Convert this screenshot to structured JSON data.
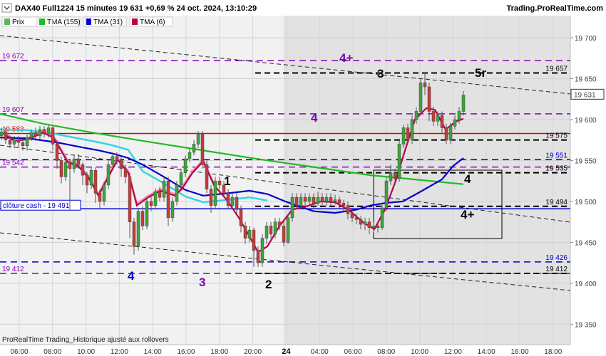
{
  "header": {
    "title": "DAX40 Full1224 15 minutes 19 631 +0,69 % 24 oct. 2024, 13:10:29",
    "source": "Trading.ProRealTime.com"
  },
  "legend": [
    {
      "label": "Prix",
      "color": "#5ab75a"
    },
    {
      "label": "TMA (155)",
      "color": "#22bb22"
    },
    {
      "label": "TMA (31)",
      "color": "#0000cc"
    },
    {
      "label": "TMA (6)",
      "color": "#b8004f"
    }
  ],
  "footer": "ProRealTime Trading_Historique ajusté aux rollovers",
  "chart_data": {
    "type": "candlestick",
    "x_ticks": [
      "06:00",
      "08:00",
      "10:00",
      "12:00",
      "14:00",
      "16:00",
      "18:00",
      "20:00",
      "24",
      "04:00",
      "06:00",
      "08:00",
      "10:00",
      "12:00",
      "14:00",
      "16:00",
      "18:00"
    ],
    "y_ticks": [
      19350,
      19400,
      19450,
      19500,
      19550,
      19600,
      19650,
      19700
    ],
    "ylim": [
      19325,
      19727
    ],
    "last_price": 19631,
    "last_price_label": "19 631",
    "levels": [
      {
        "value": 19672,
        "label": "19 672",
        "color": "#8a00b8",
        "style": "dashed",
        "side": "left"
      },
      {
        "value": 19657,
        "label": "19 657",
        "color": "#000000",
        "style": "dashed",
        "side": "right"
      },
      {
        "value": 19607,
        "label": "19 607",
        "color": "#8a00b8",
        "style": "dashed",
        "side": "left"
      },
      {
        "value": 19583,
        "label": "19 583",
        "color": "#dd0000",
        "style": "solid",
        "side": "left"
      },
      {
        "value": 19575,
        "label": "19 575",
        "color": "#000000",
        "style": "dashed",
        "side": "right"
      },
      {
        "value": 19551,
        "label": "19 551",
        "color": "#0000cc",
        "style": "dashed",
        "side": "right"
      },
      {
        "value": 19542,
        "label": "19 542",
        "color": "#8a00b8",
        "style": "dashed",
        "side": "left"
      },
      {
        "value": 19535,
        "label": "19 535",
        "color": "#000000",
        "style": "dashed",
        "side": "right"
      },
      {
        "value": 19494,
        "label": "19 494",
        "color": "#000000",
        "style": "dashed",
        "side": "right"
      },
      {
        "value": 19491,
        "label": "clôture cash -  19 491",
        "color": "#0000cc",
        "style": "solid",
        "side": "left-box"
      },
      {
        "value": 19426,
        "label": "19 426",
        "color": "#0000cc",
        "style": "dashed",
        "side": "right"
      },
      {
        "value": 19412,
        "label": "19 412",
        "color": "#8a00b8",
        "style": "dashed",
        "side": "left"
      },
      {
        "value": 19412,
        "label": "19 412",
        "color": "#000000",
        "style": "dashed",
        "side": "right"
      }
    ],
    "annotations": [
      {
        "text": "4+",
        "color": "#7a00b0"
      },
      {
        "text": "3",
        "color": "#000000"
      },
      {
        "text": "5r",
        "color": "#000000"
      },
      {
        "text": "4",
        "color": "#7a00b0"
      },
      {
        "text": "1",
        "color": "#000000"
      },
      {
        "text": "4",
        "color": "#000000"
      },
      {
        "text": "4+",
        "color": "#000000"
      },
      {
        "text": "4",
        "color": "#0000cc"
      },
      {
        "text": "3",
        "color": "#7a00b0"
      },
      {
        "text": "2",
        "color": "#000000"
      }
    ],
    "series": [
      {
        "name": "TMA (155)",
        "color": "#22bb22",
        "points": [
          [
            0,
            19607
          ],
          [
            60,
            19595
          ],
          [
            130,
            19584
          ],
          [
            200,
            19574
          ],
          [
            280,
            19563
          ],
          [
            360,
            19552
          ],
          [
            440,
            19542
          ],
          [
            520,
            19532
          ],
          [
            580,
            19527
          ],
          [
            650,
            19521
          ]
        ]
      },
      {
        "name": "TMA (31)",
        "color": "#0000cc",
        "points": [
          [
            0,
            19578
          ],
          [
            40,
            19577
          ],
          [
            80,
            19572
          ],
          [
            110,
            19567
          ],
          [
            140,
            19562
          ],
          [
            160,
            19558
          ],
          [
            180,
            19553
          ],
          [
            200,
            19545
          ],
          [
            230,
            19530
          ],
          [
            260,
            19514
          ],
          [
            285,
            19507
          ],
          [
            320,
            19510
          ],
          [
            350,
            19513
          ],
          [
            375,
            19509
          ],
          [
            400,
            19500
          ],
          [
            420,
            19494
          ],
          [
            440,
            19488
          ],
          [
            470,
            19486
          ],
          [
            500,
            19490
          ],
          [
            520,
            19495
          ],
          [
            540,
            19498
          ],
          [
            565,
            19500
          ],
          [
            590,
            19512
          ],
          [
            620,
            19527
          ],
          [
            635,
            19543
          ],
          [
            650,
            19553
          ]
        ]
      },
      {
        "name": "TMA (6)",
        "color": "#b8004f",
        "points": [
          [
            5,
            19583
          ],
          [
            20,
            19574
          ],
          [
            40,
            19576
          ],
          [
            60,
            19584
          ],
          [
            75,
            19578
          ],
          [
            95,
            19548
          ],
          [
            110,
            19543
          ],
          [
            125,
            19528
          ],
          [
            138,
            19507
          ],
          [
            152,
            19530
          ],
          [
            165,
            19551
          ],
          [
            180,
            19535
          ],
          [
            192,
            19495
          ],
          [
            208,
            19505
          ],
          [
            225,
            19513
          ],
          [
            245,
            19507
          ],
          [
            255,
            19515
          ],
          [
            270,
            19535
          ],
          [
            285,
            19549
          ],
          [
            300,
            19520
          ],
          [
            318,
            19502
          ],
          [
            335,
            19480
          ],
          [
            350,
            19457
          ],
          [
            362,
            19438
          ],
          [
            375,
            19445
          ],
          [
            392,
            19470
          ],
          [
            410,
            19490
          ],
          [
            430,
            19494
          ],
          [
            450,
            19500
          ],
          [
            470,
            19499
          ],
          [
            490,
            19489
          ],
          [
            510,
            19474
          ],
          [
            525,
            19466
          ],
          [
            540,
            19490
          ],
          [
            555,
            19525
          ],
          [
            568,
            19562
          ],
          [
            582,
            19600
          ],
          [
            598,
            19614
          ],
          [
            610,
            19612
          ],
          [
            625,
            19588
          ],
          [
            640,
            19598
          ],
          [
            650,
            19601
          ]
        ]
      }
    ],
    "candles": [
      [
        0,
        19580,
        19585,
        19575,
        19590
      ],
      [
        6,
        19585,
        19575,
        19570,
        19590
      ],
      [
        12,
        19575,
        19570,
        19565,
        19580
      ],
      [
        18,
        19570,
        19575,
        19565,
        19580
      ],
      [
        24,
        19575,
        19572,
        19566,
        19580
      ],
      [
        30,
        19572,
        19568,
        19562,
        19576
      ],
      [
        36,
        19568,
        19578,
        19562,
        19582
      ],
      [
        42,
        19578,
        19584,
        19574,
        19588
      ],
      [
        48,
        19584,
        19580,
        19574,
        19590
      ],
      [
        54,
        19580,
        19588,
        19576,
        19592
      ],
      [
        60,
        19588,
        19583,
        19578,
        19592
      ],
      [
        66,
        19583,
        19590,
        19578,
        19594
      ],
      [
        72,
        19590,
        19570,
        19562,
        19592
      ],
      [
        78,
        19570,
        19550,
        19540,
        19575
      ],
      [
        84,
        19550,
        19530,
        19522,
        19555
      ],
      [
        90,
        19530,
        19548,
        19525,
        19552
      ],
      [
        96,
        19548,
        19540,
        19490,
        19552
      ],
      [
        102,
        19540,
        19552,
        19535,
        19556
      ],
      [
        108,
        19552,
        19545,
        19540,
        19558
      ],
      [
        114,
        19545,
        19532,
        19520,
        19548
      ],
      [
        120,
        19532,
        19520,
        19510,
        19536
      ],
      [
        126,
        19520,
        19538,
        19515,
        19542
      ],
      [
        132,
        19538,
        19510,
        19498,
        19542
      ],
      [
        138,
        19510,
        19500,
        19490,
        19514
      ],
      [
        144,
        19500,
        19520,
        19495,
        19524
      ],
      [
        150,
        19520,
        19545,
        19515,
        19550
      ],
      [
        156,
        19545,
        19555,
        19540,
        19560
      ],
      [
        162,
        19555,
        19550,
        19545,
        19560
      ],
      [
        168,
        19550,
        19540,
        19530,
        19555
      ],
      [
        174,
        19540,
        19530,
        19522,
        19545
      ],
      [
        180,
        19530,
        19475,
        19455,
        19535
      ],
      [
        186,
        19475,
        19445,
        19435,
        19480
      ],
      [
        192,
        19445,
        19488,
        19440,
        19492
      ],
      [
        198,
        19488,
        19470,
        19465,
        19494
      ],
      [
        204,
        19470,
        19500,
        19466,
        19505
      ],
      [
        210,
        19500,
        19495,
        19488,
        19506
      ],
      [
        216,
        19495,
        19512,
        19490,
        19516
      ],
      [
        222,
        19512,
        19505,
        19500,
        19518
      ],
      [
        228,
        19505,
        19525,
        19500,
        19530
      ],
      [
        234,
        19525,
        19480,
        19470,
        19530
      ],
      [
        240,
        19480,
        19500,
        19475,
        19505
      ],
      [
        246,
        19500,
        19520,
        19495,
        19525
      ],
      [
        252,
        19520,
        19535,
        19515,
        19540
      ],
      [
        258,
        19535,
        19552,
        19530,
        19556
      ],
      [
        264,
        19552,
        19560,
        19548,
        19565
      ],
      [
        270,
        19560,
        19570,
        19556,
        19575
      ],
      [
        276,
        19570,
        19582,
        19565,
        19586
      ],
      [
        282,
        19582,
        19545,
        19540,
        19586
      ],
      [
        288,
        19545,
        19515,
        19510,
        19550
      ],
      [
        294,
        19515,
        19495,
        19486,
        19520
      ],
      [
        300,
        19495,
        19525,
        19490,
        19530
      ],
      [
        306,
        19525,
        19520,
        19515,
        19530
      ],
      [
        312,
        19520,
        19510,
        19505,
        19525
      ],
      [
        318,
        19510,
        19495,
        19490,
        19515
      ],
      [
        324,
        19495,
        19505,
        19490,
        19510
      ],
      [
        330,
        19505,
        19490,
        19485,
        19510
      ],
      [
        336,
        19490,
        19470,
        19462,
        19495
      ],
      [
        342,
        19470,
        19455,
        19448,
        19475
      ],
      [
        348,
        19455,
        19465,
        19450,
        19470
      ],
      [
        354,
        19465,
        19440,
        19420,
        19468
      ],
      [
        360,
        19440,
        19425,
        19420,
        19445
      ],
      [
        366,
        19425,
        19455,
        19420,
        19460
      ],
      [
        372,
        19455,
        19470,
        19448,
        19475
      ],
      [
        378,
        19470,
        19460,
        19455,
        19475
      ],
      [
        384,
        19460,
        19475,
        19455,
        19480
      ],
      [
        390,
        19475,
        19470,
        19465,
        19480
      ],
      [
        396,
        19470,
        19450,
        19445,
        19475
      ],
      [
        402,
        19450,
        19480,
        19448,
        19485
      ],
      [
        408,
        19480,
        19505,
        19475,
        19510
      ],
      [
        414,
        19505,
        19495,
        19490,
        19510
      ],
      [
        420,
        19495,
        19505,
        19490,
        19510
      ],
      [
        426,
        19505,
        19500,
        19495,
        19510
      ],
      [
        432,
        19500,
        19505,
        19495,
        19510
      ],
      [
        438,
        19505,
        19498,
        19492,
        19510
      ],
      [
        444,
        19498,
        19505,
        19495,
        19512
      ],
      [
        450,
        19505,
        19500,
        19495,
        19510
      ],
      [
        456,
        19500,
        19505,
        19495,
        19510
      ],
      [
        462,
        19505,
        19500,
        19495,
        19510
      ],
      [
        468,
        19500,
        19502,
        19496,
        19508
      ],
      [
        474,
        19502,
        19498,
        19492,
        19506
      ],
      [
        480,
        19498,
        19495,
        19488,
        19502
      ],
      [
        486,
        19495,
        19485,
        19478,
        19500
      ],
      [
        492,
        19485,
        19480,
        19475,
        19490
      ],
      [
        498,
        19480,
        19478,
        19472,
        19485
      ],
      [
        504,
        19478,
        19472,
        19466,
        19482
      ],
      [
        510,
        19472,
        19475,
        19465,
        19480
      ],
      [
        516,
        19475,
        19468,
        19460,
        19480
      ],
      [
        522,
        19468,
        19470,
        19462,
        19475
      ],
      [
        528,
        19470,
        19468,
        19462,
        19474
      ],
      [
        534,
        19468,
        19492,
        19465,
        19496
      ],
      [
        540,
        19492,
        19525,
        19488,
        19530
      ],
      [
        546,
        19525,
        19535,
        19520,
        19545
      ],
      [
        552,
        19535,
        19528,
        19520,
        19540
      ],
      [
        558,
        19528,
        19570,
        19524,
        19575
      ],
      [
        564,
        19570,
        19590,
        19565,
        19594
      ],
      [
        570,
        19590,
        19575,
        19570,
        19595
      ],
      [
        576,
        19575,
        19600,
        19570,
        19605
      ],
      [
        582,
        19600,
        19610,
        19595,
        19615
      ],
      [
        588,
        19610,
        19645,
        19605,
        19650
      ],
      [
        594,
        19645,
        19640,
        19630,
        19658
      ],
      [
        600,
        19640,
        19610,
        19598,
        19645
      ],
      [
        606,
        19610,
        19598,
        19592,
        19616
      ],
      [
        612,
        19598,
        19605,
        19592,
        19610
      ],
      [
        618,
        19605,
        19590,
        19584,
        19610
      ],
      [
        624,
        19590,
        19575,
        19570,
        19595
      ],
      [
        630,
        19575,
        19592,
        19570,
        19596
      ],
      [
        636,
        19592,
        19600,
        19588,
        19605
      ],
      [
        642,
        19600,
        19610,
        19595,
        19615
      ],
      [
        648,
        19610,
        19630,
        19605,
        19635
      ]
    ]
  }
}
